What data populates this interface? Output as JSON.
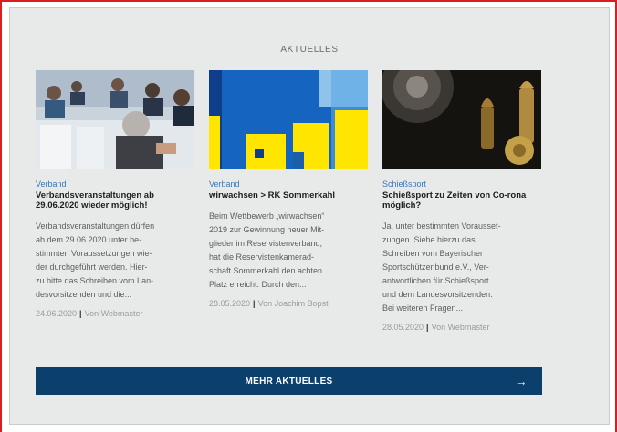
{
  "section": {
    "title": "AKTUELLES"
  },
  "articles": [
    {
      "category": "Verband",
      "headline": "Verbandsveranstaltungen ab 29.06.2020 wieder möglich!",
      "excerpt": "Verbandsveranstaltungen dürfen\nab dem 29.06.2020 unter be-\nstimmten Voraussetzungen wie-\nder durchgeführt werden.   Hier-\nzu bitte das Schreiben vom Lan-\ndesvorsitzenden und die...",
      "date": "24.06.2020",
      "author": "Von Webmaster",
      "image": "conference-audience-photo"
    },
    {
      "category": "Verband",
      "headline": "wirwachsen > RK Sommerkahl",
      "excerpt": "Beim Wettbewerb „wirwachsen“\n2019 zur Gewinnung neuer Mit-\nglieder im Reservistenverband,\nhat die Reservistenkamerad-\nschaft Sommerkahl den achten\nPlatz erreicht. Durch den...",
      "date": "28.05.2020",
      "author": "Von Joachim Bopst",
      "image": "wirwachsen-graphic"
    },
    {
      "category": "Schießsport",
      "headline": "Schießsport zu Zeiten von Co-rona möglich?",
      "excerpt": "Ja, unter bestimmten Vorausset-\nzungen. Siehe hierzu das\nSchreiben vom Bayerischer\nSportschützenbund e.V.,   Ver-\nantwortlichen für Schießsport\nund dem Landesvorsitzenden.\nBei weiteren Fragen...",
      "date": "28.05.2020",
      "author": "Von Webmaster",
      "image": "ammunition-target-photo"
    }
  ],
  "meta_separator": "|",
  "more_button": {
    "label": "MEHR AKTUELLES",
    "arrow": "→"
  },
  "colors": {
    "frame": "#d81e1e",
    "panel": "#e8eaea",
    "link": "#3a78b8",
    "button": "#0b3f6c"
  }
}
